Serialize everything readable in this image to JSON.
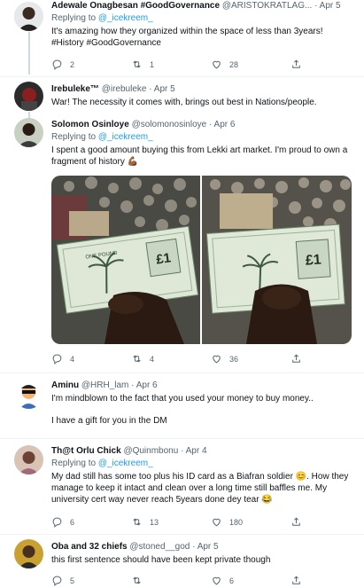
{
  "tweets": [
    {
      "name": "Adewale Onagbesan #GoodGovernance",
      "handle": "@ARISTOKRATLAG... · Apr 5",
      "reply_prefix": "Replying to ",
      "reply_to": "@_icekreem_",
      "text": "It's amazing how they organized within the space of less than 3years!",
      "hashtags": "#History #GoodGovernance",
      "replies": "2",
      "retweets": "1",
      "likes": "28"
    },
    {
      "name": "Irebuleke™",
      "handle": "@irebuleke · Apr 5",
      "text": "War! The necessity it comes with, brings out best in Nations/people."
    },
    {
      "name": "Solomon Osinloye",
      "handle": "@solomonosinloye · Apr 6",
      "reply_prefix": "Replying to ",
      "reply_to": "@_icekreem_",
      "text": "I spent a good amount buying this from Lekki art market. I'm proud to own a fragment of history 💪🏾",
      "replies": "4",
      "retweets": "4",
      "likes": "36"
    },
    {
      "name": "Aminu",
      "handle": "@HRH_lam · Apr 6",
      "text": "I'm mindblown to the fact that you used your money to buy money..",
      "text2": "I have a gift for you in the DM"
    },
    {
      "name": "Th@t Orlu Chick",
      "handle": "@Quinmbonu · Apr 4",
      "reply_prefix": "Replying to ",
      "reply_to": "@_icekreem_",
      "text": "My dad still has some too plus his ID card as a Biafran soldier 😊. How they manage to keep it intact and clean over a long time still baffles me. My university cert way never reach 5years done dey tear 😂",
      "replies": "6",
      "retweets": "13",
      "likes": "180"
    },
    {
      "name": "Oba and 32 chiefs",
      "handle": "@stoned__god · Apr 5",
      "text": "this first sentence should have been kept private though",
      "replies": "5",
      "retweets": "",
      "likes": "6"
    }
  ],
  "banknote": {
    "denomination": "£1",
    "label": "ONE POUND"
  },
  "colors": {
    "link": "#1d9bf0",
    "muted": "#536471",
    "divider": "#eff3f4",
    "thread": "#cfd9de"
  }
}
